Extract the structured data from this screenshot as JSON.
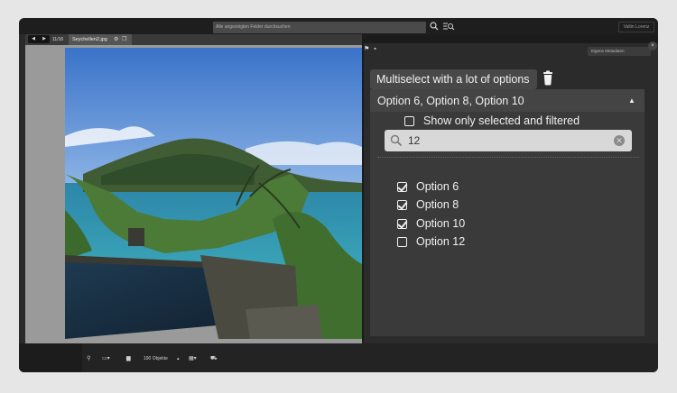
{
  "topbar": {
    "search_placeholder": "Alle angezeigten Felder durchsuchen",
    "search_icon": "magnifier",
    "advanced_search_icon": "list-search",
    "user_name": "Valtin Lorenz"
  },
  "viewer": {
    "nav_prev": "◀",
    "nav_next": "▶",
    "count": "11/16",
    "filename": "Seychellen2.jpg",
    "tab_icons": [
      "gear-icon",
      "copy-icon"
    ]
  },
  "panel": {
    "selector": "Eigene Metadaten",
    "close_label": "×",
    "title": "Multiselect with a lot of options",
    "multiselect": {
      "selected_summary": "Option 6, Option 8, Option 10",
      "show_only_selected_label": "Show only selected and filtered",
      "show_only_selected_checked": false,
      "filter_value": "12",
      "options": [
        {
          "label": "Option 6",
          "checked": true
        },
        {
          "label": "Option 8",
          "checked": true
        },
        {
          "label": "Option 10",
          "checked": true
        },
        {
          "label": "Option 12",
          "checked": false
        }
      ]
    }
  },
  "bottombar": {
    "objects_label": "190 Objekte",
    "icons": [
      "pin-icon",
      "panel-icon",
      "folder-icon",
      "grid-icon",
      "cart-icon"
    ]
  },
  "colors": {
    "app_bg": "#1b1b1b",
    "panel_bg": "#2b2b2b",
    "multiselect_bg": "#3a3a3a",
    "filter_bg": "#d8d8d8",
    "text": "#f0f0f0"
  }
}
